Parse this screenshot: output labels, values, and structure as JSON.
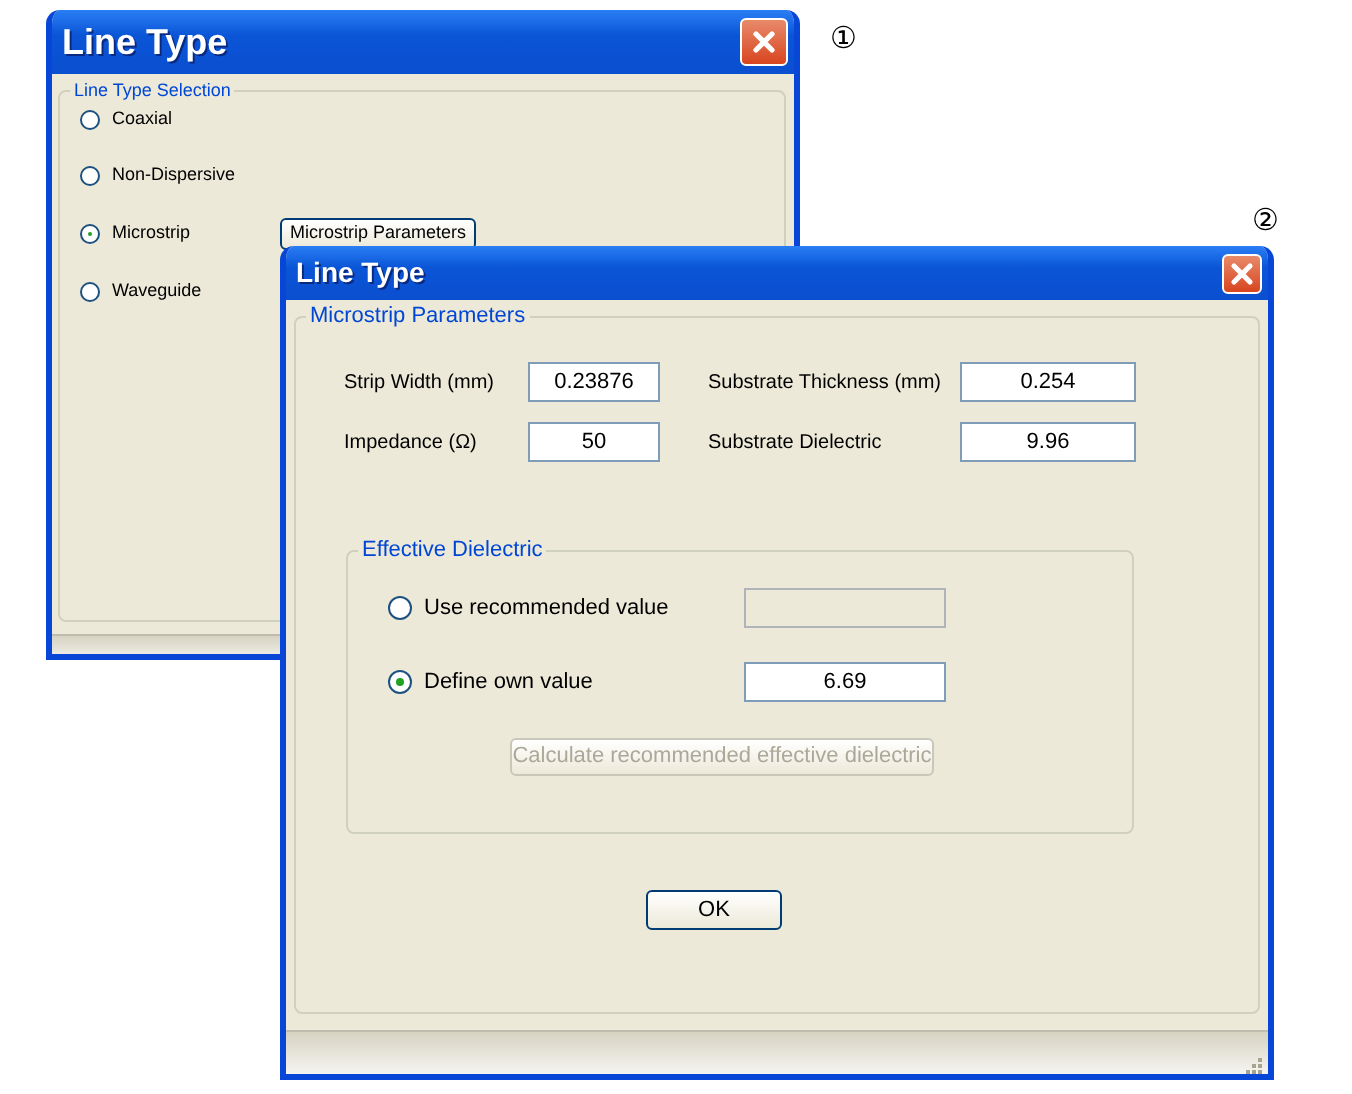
{
  "windows": [
    {
      "title": "Line Type",
      "callout": "①",
      "group": {
        "label": "Line Type Selection",
        "options": [
          {
            "label": "Coaxial",
            "selected": false
          },
          {
            "label": "Non-Dispersive",
            "selected": false
          },
          {
            "label": "Microstrip",
            "selected": true,
            "button": "Microstrip Parameters"
          },
          {
            "label": "Waveguide",
            "selected": false
          }
        ]
      }
    },
    {
      "title": "Line Type",
      "callout": "②",
      "group": {
        "label": "Microstrip Parameters",
        "fields": [
          {
            "label": "Strip Width (mm)",
            "value": "0.23876"
          },
          {
            "label": "Substrate Thickness (mm)",
            "value": "0.254"
          },
          {
            "label": "Impedance (Ω)",
            "value": "50"
          },
          {
            "label": "Substrate Dielectric",
            "value": "9.96"
          }
        ],
        "subgroup": {
          "label": "Effective Dielectric",
          "options": [
            {
              "label": "Use recommended value",
              "selected": false,
              "field_disabled": true
            },
            {
              "label": "Define own value",
              "selected": true,
              "value": "6.69",
              "field_disabled": false
            }
          ],
          "calc_button": {
            "label": "Calculate recommended effective dielectric",
            "disabled": true
          }
        }
      },
      "ok_button": "OK"
    }
  ]
}
